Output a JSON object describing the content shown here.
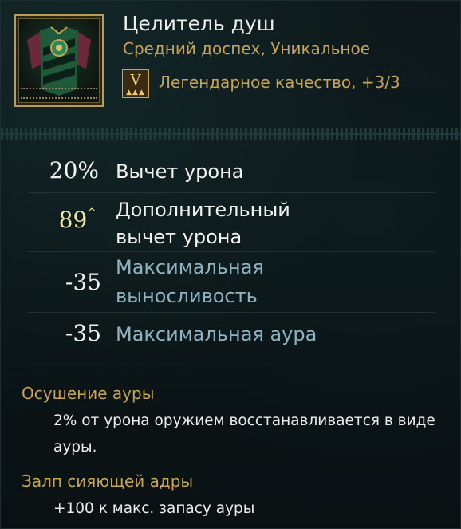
{
  "item": {
    "name": "Целитель душ",
    "type": "Средний доспех, Уникальное",
    "quality_badge": "V",
    "quality_text": "Легендарное качество, +3/3"
  },
  "stats": [
    {
      "value": "20%",
      "label": "Вычет урона",
      "color": "#f2f2ee"
    },
    {
      "value": "89",
      "label_line1": "Дополнительный",
      "label_line2": "вычет урона",
      "color": "#f4e6a8"
    },
    {
      "value": "-35",
      "label_line1": "Максимальная",
      "label_line2": "выносливость",
      "color": "#8fb3c2"
    },
    {
      "value": "-35",
      "label": "Максимальная аура",
      "color": "#8fb3c2"
    }
  ],
  "effects": [
    {
      "title": "Осушение ауры",
      "desc": "2% от урона оружием восстанавливается в виде ауры."
    },
    {
      "title": "Залп сияющей адры",
      "desc": "+100 к макс. запасу ауры"
    }
  ],
  "colors": {
    "accent_gold": "#c8a456",
    "stat_blue": "#8fb3c2",
    "background": "#0a1214"
  },
  "icons": {
    "item": "chest-armor-icon",
    "quality": "legendary-badge-icon",
    "upgrade": "caret-up-icon"
  }
}
